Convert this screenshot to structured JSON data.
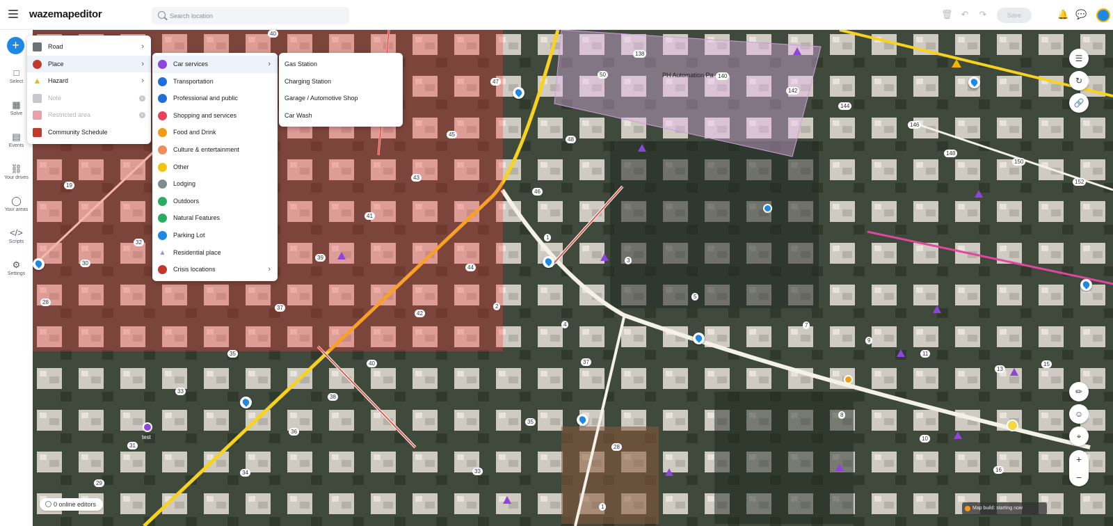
{
  "app": {
    "logo": "wazemapeditor"
  },
  "search": {
    "placeholder": "Search location"
  },
  "toolbar": {
    "save_label": "Save"
  },
  "rail": {
    "items": [
      {
        "label": "Select"
      },
      {
        "label": "Solve"
      },
      {
        "label": "Events"
      },
      {
        "label": "Your drives"
      },
      {
        "label": "Your areas"
      },
      {
        "label": "Scripts"
      },
      {
        "label": "Settings"
      }
    ]
  },
  "menu_level1": {
    "items": [
      {
        "label": "Road",
        "icon": "road-icon",
        "has_submenu": true,
        "disabled": false
      },
      {
        "label": "Place",
        "icon": "place-pin-icon",
        "has_submenu": true,
        "disabled": false
      },
      {
        "label": "Hazard",
        "icon": "hazard-icon",
        "has_submenu": true,
        "disabled": false
      },
      {
        "label": "Note",
        "icon": "note-icon",
        "has_submenu": false,
        "disabled": true
      },
      {
        "label": "Restricted area",
        "icon": "restricted-area-icon",
        "has_submenu": false,
        "disabled": true
      },
      {
        "label": "Community Schedule",
        "icon": "calendar-icon",
        "has_submenu": false,
        "disabled": false
      }
    ]
  },
  "menu_level2": {
    "items": [
      {
        "label": "Car services",
        "color": "#8e44dd",
        "has_submenu": true
      },
      {
        "label": "Transportation",
        "color": "#1e6fd9",
        "has_submenu": false
      },
      {
        "label": "Professional and public",
        "color": "#1e6fd9",
        "has_submenu": false
      },
      {
        "label": "Shopping and services",
        "color": "#e8425a",
        "has_submenu": false
      },
      {
        "label": "Food and Drink",
        "color": "#f39c12",
        "has_submenu": false
      },
      {
        "label": "Culture & entertainment",
        "color": "#f28c5a",
        "has_submenu": false
      },
      {
        "label": "Other",
        "color": "#f1c40f",
        "has_submenu": false
      },
      {
        "label": "Lodging",
        "color": "#7f8c8d",
        "has_submenu": false
      },
      {
        "label": "Outdoors",
        "color": "#27ae60",
        "has_submenu": false
      },
      {
        "label": "Natural Features",
        "color": "#27ae60",
        "has_submenu": false
      },
      {
        "label": "Parking Lot",
        "color": "#1e88e5",
        "has_submenu": false
      },
      {
        "label": "Residential place",
        "color": "#b07ee8",
        "has_submenu": false
      },
      {
        "label": "Crisis locations",
        "color": "#c0392b",
        "has_submenu": true
      }
    ]
  },
  "menu_level3": {
    "items": [
      {
        "label": "Gas Station"
      },
      {
        "label": "Charging Station"
      },
      {
        "label": "Garage / Automotive Shop"
      },
      {
        "label": "Car Wash"
      }
    ]
  },
  "map": {
    "place_label": "PH Automation Pa",
    "pin_test_label": "test",
    "online_editors": "0 online editors",
    "map_status": "Map build: starting now",
    "house_numbers": [
      "40",
      "138",
      "50",
      "140",
      "142",
      "144",
      "146",
      "148",
      "150",
      "152",
      "47",
      "45",
      "48",
      "46",
      "43",
      "41",
      "39",
      "44",
      "42",
      "37",
      "35",
      "33",
      "38",
      "40",
      "36",
      "34",
      "31",
      "29",
      "32",
      "30",
      "28",
      "19",
      "2",
      "1",
      "3",
      "5",
      "4",
      "7",
      "9",
      "11",
      "13",
      "15",
      "37",
      "35",
      "33",
      "28",
      "1",
      "8",
      "10",
      "16"
    ]
  }
}
